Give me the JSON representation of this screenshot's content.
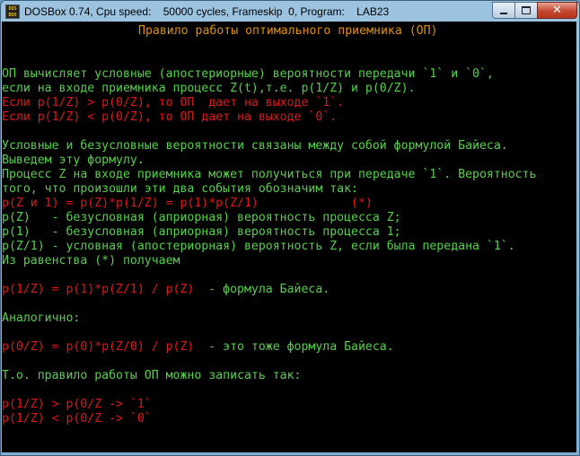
{
  "window": {
    "title": "DOSBox 0.74, Cpu speed:    50000 cycles, Frameskip  0, Program:    LAB23",
    "icon_text": "DOS BOX",
    "icon": "dosbox-icon",
    "controls": {
      "minimize": "minimize-icon",
      "maximize": "maximize-icon",
      "close": "close-icon",
      "close_glyph": "✕"
    }
  },
  "colors": {
    "green": "#55d14a",
    "red": "#e01818",
    "orange": "#e08f00",
    "background": "#000000"
  },
  "screen": {
    "heading": "Правило работы оптимального приемника (ОП)",
    "lines": [
      "ОП вычисляет условные (апостериорные) вероятности передачи `1` и `0`,",
      "если на входе приемника процесс Z(t),т.е. p(1/Z) и p(0/Z).",
      "Если p(1/Z) > p(0/Z), то ОП  дает на выходе `1`.",
      "Если p(1/Z) < p(0/Z), то ОП дает на выходе `0`.",
      "Условные и безусловные вероятности связаны между собой формулой Байеса.",
      "Выведем эту формулу.",
      "Процесс Z на входе приемника может получиться при передаче `1`. Вероятность",
      "того, что произошли эти два события обозначим так:",
      "p(Z и 1) = p(Z)*p(1/Z) = p(1)*p(Z/1)             (*)",
      "p(Z)   - безусловная (априорная) вероятность процесса Z;",
      "p(1)   - безусловная (априорная) вероятность процесса 1;",
      "p(Z/1) - условная (апостериорная) вероятность Z, если была передана `1`.",
      "Из равенства (*) получаем",
      "p(1/Z) = p(1)*p(Z/1) / p(Z)",
      "  - формула Байеса.",
      "Аналогично:",
      "p(0/Z) = p(0)*p(Z/0) / p(Z)",
      "  - это тоже формула Байеса.",
      "Т.о. правило работы ОП можно записать так:",
      "p(1/Z) > p(0/Z -> `1`",
      "p(1/Z) < p(0/Z -> `0`"
    ]
  }
}
